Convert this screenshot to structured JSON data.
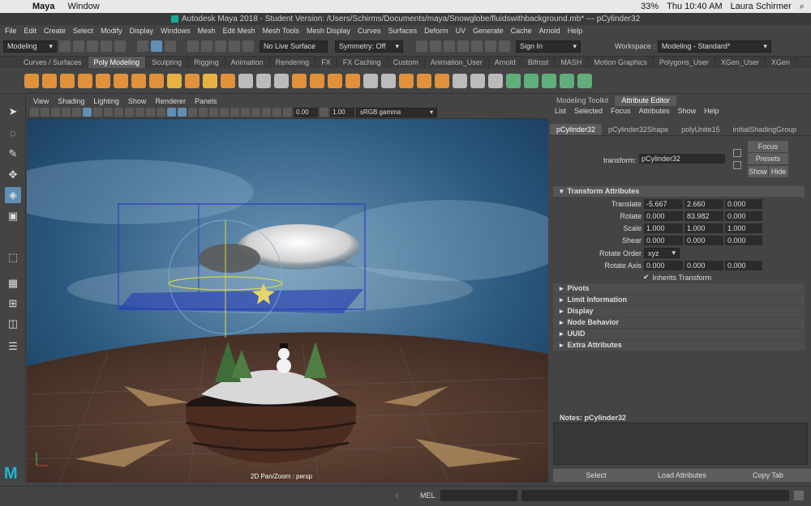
{
  "mac": {
    "apple": "",
    "app": "Maya",
    "menu": "Window",
    "battery": "33%",
    "time": "Thu 10:40 AM",
    "user": "Laura Schirmer"
  },
  "title": "Autodesk Maya 2018 - Student Version: /Users/Schirms/Documents/maya/Snowglobe/fluidswithbackground.mb*  ---  pCylinder32",
  "menus": [
    "File",
    "Edit",
    "Create",
    "Select",
    "Modify",
    "Display",
    "Windows",
    "Mesh",
    "Edit Mesh",
    "Mesh Tools",
    "Mesh Display",
    "Curves",
    "Surfaces",
    "Deform",
    "UV",
    "Generate",
    "Cache",
    "Arnold",
    "Help"
  ],
  "workspace_label": "Workspace :",
  "workspace_value": "Modeling - Standard*",
  "mode": "Modeling",
  "live_surface": "No Live Surface",
  "symmetry": "Symmetry: Off",
  "sign_in": "Sign In",
  "shelf_tabs": [
    "Curves / Surfaces",
    "Poly Modeling",
    "Sculpting",
    "Rigging",
    "Animation",
    "Rendering",
    "FX",
    "FX Caching",
    "Custom",
    "Animation_User",
    "Arnold",
    "Bifrost",
    "MASH",
    "Motion Graphics",
    "Polygons_User",
    "XGen_User",
    "XGen"
  ],
  "viewport": {
    "menus": [
      "View",
      "Shading",
      "Lighting",
      "Show",
      "Renderer",
      "Panels"
    ],
    "exposure": "0.00",
    "gamma": "1.00",
    "colorspace": "sRGB gamma",
    "hud": "2D Pan/Zoom : persp"
  },
  "panel": {
    "tabs": [
      "Modeling Toolkit",
      "Attribute Editor"
    ],
    "menu": [
      "List",
      "Selected",
      "Focus",
      "Attributes",
      "Show",
      "Help"
    ],
    "node_tabs": [
      "pCylinder32",
      "pCylinder32Shape",
      "polyUnite15",
      "initialShadingGroup"
    ],
    "transform_label": "transform:",
    "transform_value": "pCylinder32",
    "focus": "Focus",
    "presets": "Presets",
    "show": "Show",
    "hide": "Hide",
    "section": "Transform Attributes",
    "attrs": [
      {
        "label": "Translate",
        "v": [
          "-5.667",
          "2.660",
          "0.000"
        ]
      },
      {
        "label": "Rotate",
        "v": [
          "0.000",
          "83.982",
          "0.000"
        ]
      },
      {
        "label": "Scale",
        "v": [
          "1.000",
          "1.000",
          "1.000"
        ]
      },
      {
        "label": "Shear",
        "v": [
          "0.000",
          "0.000",
          "0.000"
        ]
      }
    ],
    "rotate_order_label": "Rotate Order",
    "rotate_order": "xyz",
    "rotate_axis_label": "Rotate Axis",
    "rotate_axis": [
      "0.000",
      "0.000",
      "0.000"
    ],
    "inherits": "Inherits Transform",
    "collapsed": [
      "Pivots",
      "Limit Information",
      "Display",
      "Node Behavior",
      "UUID",
      "Extra Attributes"
    ],
    "notes": "Notes:  pCylinder32",
    "select": "Select",
    "load": "Load Attributes",
    "copy": "Copy Tab"
  },
  "cmd_lang": "MEL"
}
